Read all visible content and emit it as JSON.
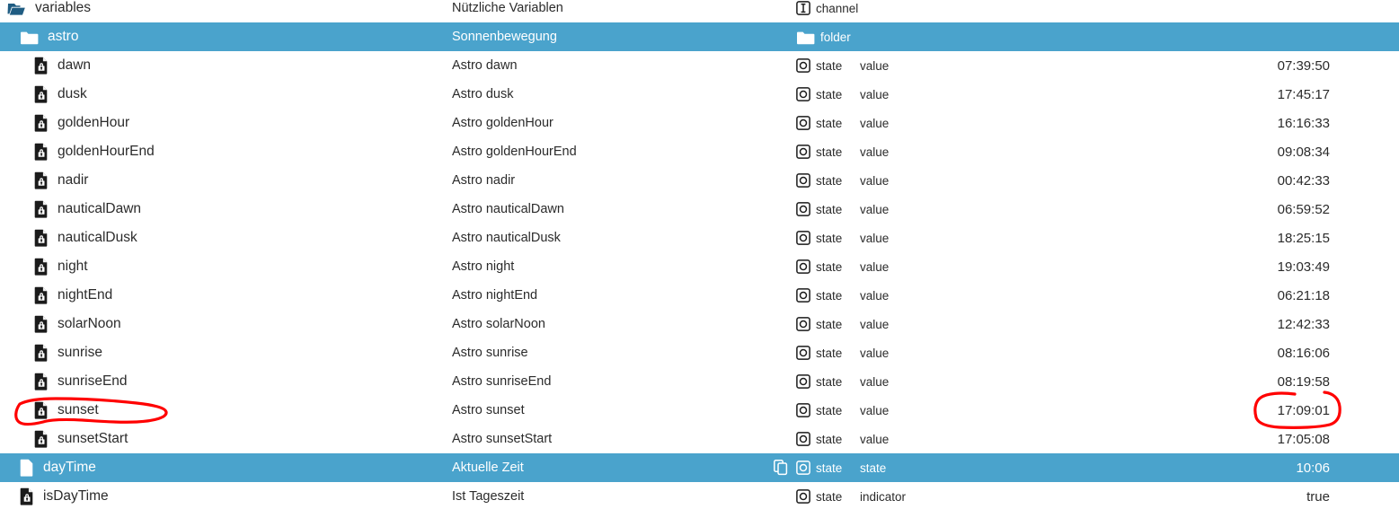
{
  "window": {
    "background_color": "#ffffff",
    "selection_color": "#4aa3cc",
    "text_color": "#2b2b2b",
    "annotation_color": "#ff0000"
  },
  "tree": {
    "rows": [
      {
        "name": "variables",
        "description": "Nützliche Variablen",
        "type_icon": "channel-icon",
        "type": "channel",
        "role": "",
        "value": "",
        "level": 0,
        "selected": false,
        "has_copy_icon": false
      },
      {
        "name": "astro",
        "description": "Sonnenbewegung",
        "type_icon": "folder-icon",
        "type": "folder",
        "role": "",
        "value": "",
        "level": 1,
        "selected": true,
        "has_copy_icon": false
      },
      {
        "name": "dawn",
        "description": "Astro dawn",
        "type_icon": "state-icon",
        "type": "state",
        "role": "value",
        "value": "07:39:50",
        "level": 2,
        "selected": false,
        "has_copy_icon": false
      },
      {
        "name": "dusk",
        "description": "Astro dusk",
        "type_icon": "state-icon",
        "type": "state",
        "role": "value",
        "value": "17:45:17",
        "level": 2,
        "selected": false,
        "has_copy_icon": false
      },
      {
        "name": "goldenHour",
        "description": "Astro goldenHour",
        "type_icon": "state-icon",
        "type": "state",
        "role": "value",
        "value": "16:16:33",
        "level": 2,
        "selected": false,
        "has_copy_icon": false
      },
      {
        "name": "goldenHourEnd",
        "description": "Astro goldenHourEnd",
        "type_icon": "state-icon",
        "type": "state",
        "role": "value",
        "value": "09:08:34",
        "level": 2,
        "selected": false,
        "has_copy_icon": false
      },
      {
        "name": "nadir",
        "description": "Astro nadir",
        "type_icon": "state-icon",
        "type": "state",
        "role": "value",
        "value": "00:42:33",
        "level": 2,
        "selected": false,
        "has_copy_icon": false
      },
      {
        "name": "nauticalDawn",
        "description": "Astro nauticalDawn",
        "type_icon": "state-icon",
        "type": "state",
        "role": "value",
        "value": "06:59:52",
        "level": 2,
        "selected": false,
        "has_copy_icon": false
      },
      {
        "name": "nauticalDusk",
        "description": "Astro nauticalDusk",
        "type_icon": "state-icon",
        "type": "state",
        "role": "value",
        "value": "18:25:15",
        "level": 2,
        "selected": false,
        "has_copy_icon": false
      },
      {
        "name": "night",
        "description": "Astro night",
        "type_icon": "state-icon",
        "type": "state",
        "role": "value",
        "value": "19:03:49",
        "level": 2,
        "selected": false,
        "has_copy_icon": false
      },
      {
        "name": "nightEnd",
        "description": "Astro nightEnd",
        "type_icon": "state-icon",
        "type": "state",
        "role": "value",
        "value": "06:21:18",
        "level": 2,
        "selected": false,
        "has_copy_icon": false
      },
      {
        "name": "solarNoon",
        "description": "Astro solarNoon",
        "type_icon": "state-icon",
        "type": "state",
        "role": "value",
        "value": "12:42:33",
        "level": 2,
        "selected": false,
        "has_copy_icon": false
      },
      {
        "name": "sunrise",
        "description": "Astro sunrise",
        "type_icon": "state-icon",
        "type": "state",
        "role": "value",
        "value": "08:16:06",
        "level": 2,
        "selected": false,
        "has_copy_icon": false
      },
      {
        "name": "sunriseEnd",
        "description": "Astro sunriseEnd",
        "type_icon": "state-icon",
        "type": "state",
        "role": "value",
        "value": "08:19:58",
        "level": 2,
        "selected": false,
        "has_copy_icon": false
      },
      {
        "name": "sunset",
        "description": "Astro sunset",
        "type_icon": "state-icon",
        "type": "state",
        "role": "value",
        "value": "17:09:01",
        "level": 2,
        "selected": false,
        "has_copy_icon": false
      },
      {
        "name": "sunsetStart",
        "description": "Astro sunsetStart",
        "type_icon": "state-icon",
        "type": "state",
        "role": "value",
        "value": "17:05:08",
        "level": 2,
        "selected": false,
        "has_copy_icon": false
      },
      {
        "name": "dayTime",
        "description": "Aktuelle Zeit",
        "type_icon": "state-icon",
        "type": "state",
        "role": "state",
        "value": "10:06",
        "level": 1,
        "selected": true,
        "has_copy_icon": true
      },
      {
        "name": "isDayTime",
        "description": "Ist Tageszeit",
        "type_icon": "state-icon",
        "type": "state",
        "role": "indicator",
        "value": "true",
        "level": 1,
        "selected": false,
        "has_copy_icon": false
      }
    ]
  },
  "annotations": [
    {
      "id": "sunset-name-circle",
      "target": "sunset",
      "shape": "hand-drawn-ellipse",
      "color": "#ff0000"
    },
    {
      "id": "sunset-value-circle",
      "target": "17:09:01",
      "shape": "hand-drawn-ellipse",
      "color": "#ff0000"
    }
  ]
}
